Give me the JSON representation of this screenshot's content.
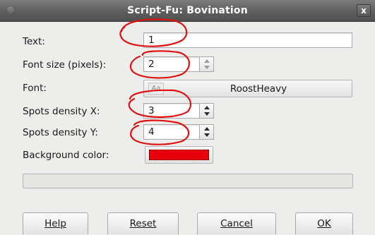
{
  "window": {
    "title": "Script-Fu: Bovination",
    "close_glyph": "x"
  },
  "fields": {
    "text": {
      "label": "Text:",
      "value": "1"
    },
    "font_size": {
      "label": "Font size (pixels):",
      "value": "2"
    },
    "font": {
      "label": "Font:",
      "value": "RoostHeavy",
      "preview_glyph": "Aa"
    },
    "spots_x": {
      "label": "Spots density X:",
      "value": "3"
    },
    "spots_y": {
      "label": "Spots density Y:",
      "value": "4"
    },
    "background": {
      "label": "Background color:",
      "color": "#e8000c"
    }
  },
  "buttons": {
    "help": "Help",
    "reset": "Reset",
    "cancel": "Cancel",
    "ok": "OK"
  },
  "annotation_color": "#e21010"
}
